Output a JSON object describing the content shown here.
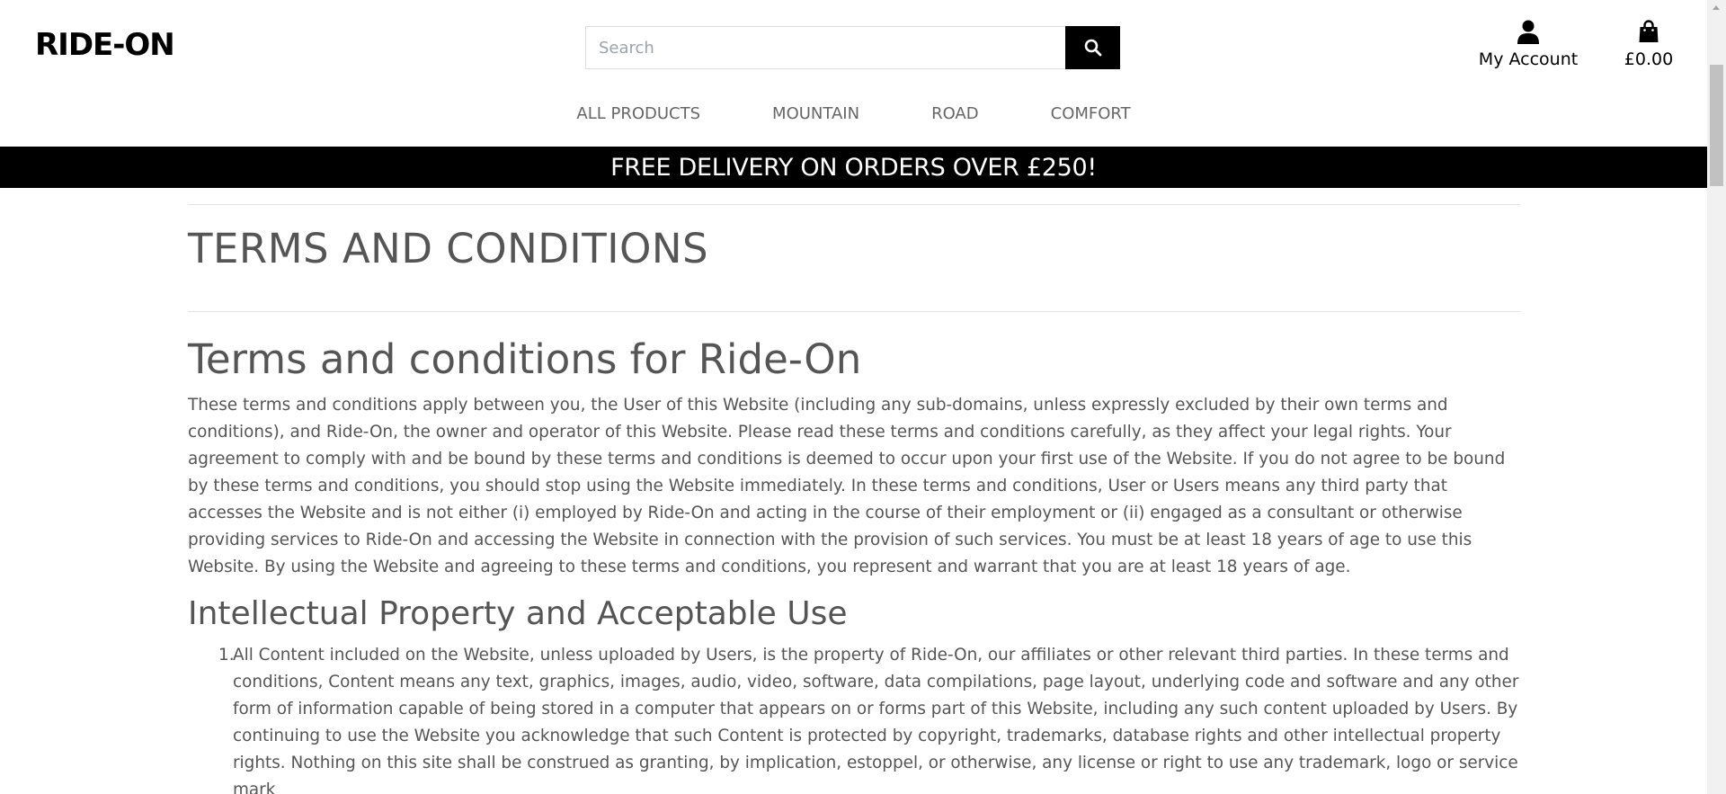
{
  "header": {
    "logo": "RIDE-ON",
    "search": {
      "placeholder": "Search"
    },
    "account_label": "My Account",
    "cart_total": "£0.00"
  },
  "nav": {
    "items": [
      {
        "label": "ALL PRODUCTS"
      },
      {
        "label": "MOUNTAIN"
      },
      {
        "label": "ROAD"
      },
      {
        "label": "COMFORT"
      }
    ]
  },
  "banner": {
    "text": "FREE DELIVERY ON ORDERS OVER £250!"
  },
  "main": {
    "page_title": "TERMS AND CONDITIONS",
    "doc_title": "Terms and conditions for Ride-On",
    "intro": "These terms and conditions apply between you, the User of this Website (including any sub-domains, unless expressly excluded by their own terms and conditions), and Ride-On, the owner and operator of this Website. Please read these terms and conditions carefully, as they affect your legal rights. Your agreement to comply with and be bound by these terms and conditions is deemed to occur upon your first use of the Website. If you do not agree to be bound by these terms and conditions, you should stop using the Website immediately. In these terms and conditions, User or Users means any third party that accesses the Website and is not either (i) employed by Ride-On and acting in the course of their employment or (ii) engaged as a consultant or otherwise providing services to Ride-On and accessing the Website in connection with the provision of such services. You must be at least 18 years of age to use this Website. By using the Website and agreeing to these terms and conditions, you represent and warrant that you are at least 18 years of age.",
    "section_title": "Intellectual Property and Acceptable Use",
    "list": [
      {
        "num": "1.",
        "text": "All Content included on the Website, unless uploaded by Users, is the property of Ride-On, our affiliates or other relevant third parties. In these terms and conditions, Content means any text, graphics, images, audio, video, software, data compilations, page layout, underlying code and software and any other form of information capable of being stored in a computer that appears on or forms part of this Website, including any such content uploaded by Users. By continuing to use the Website you acknowledge that such Content is protected by copyright, trademarks, database rights and other intellectual property rights. Nothing on this site shall be construed as granting, by implication, estoppel, or otherwise, any license or right to use any trademark, logo or service mark"
      }
    ]
  }
}
